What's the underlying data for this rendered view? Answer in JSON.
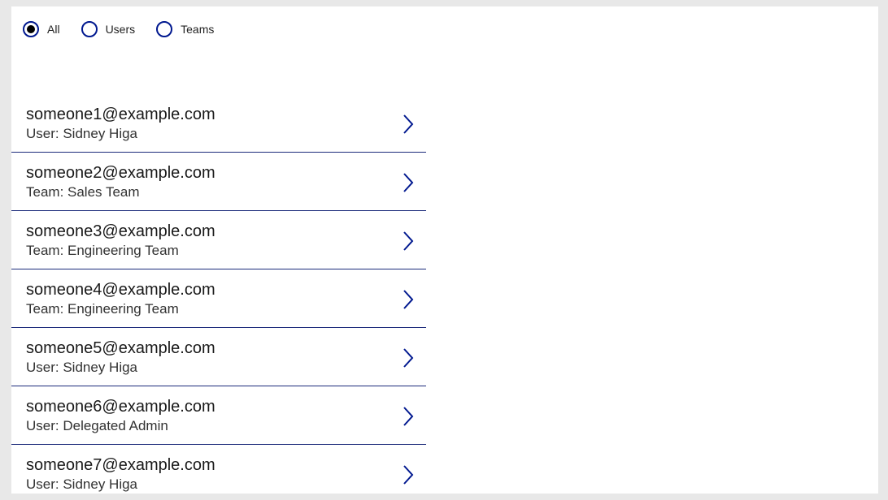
{
  "filters": {
    "options": [
      {
        "id": "all",
        "label": "All",
        "selected": true
      },
      {
        "id": "users",
        "label": "Users",
        "selected": false
      },
      {
        "id": "teams",
        "label": "Teams",
        "selected": false
      }
    ]
  },
  "list": {
    "items": [
      {
        "email": "someone1@example.com",
        "subtitle": "User: Sidney Higa"
      },
      {
        "email": "someone2@example.com",
        "subtitle": "Team: Sales Team"
      },
      {
        "email": "someone3@example.com",
        "subtitle": "Team: Engineering Team"
      },
      {
        "email": "someone4@example.com",
        "subtitle": "Team: Engineering Team"
      },
      {
        "email": "someone5@example.com",
        "subtitle": "User: Sidney Higa"
      },
      {
        "email": "someone6@example.com",
        "subtitle": "User: Delegated Admin"
      },
      {
        "email": "someone7@example.com",
        "subtitle": "User: Sidney Higa"
      }
    ]
  }
}
